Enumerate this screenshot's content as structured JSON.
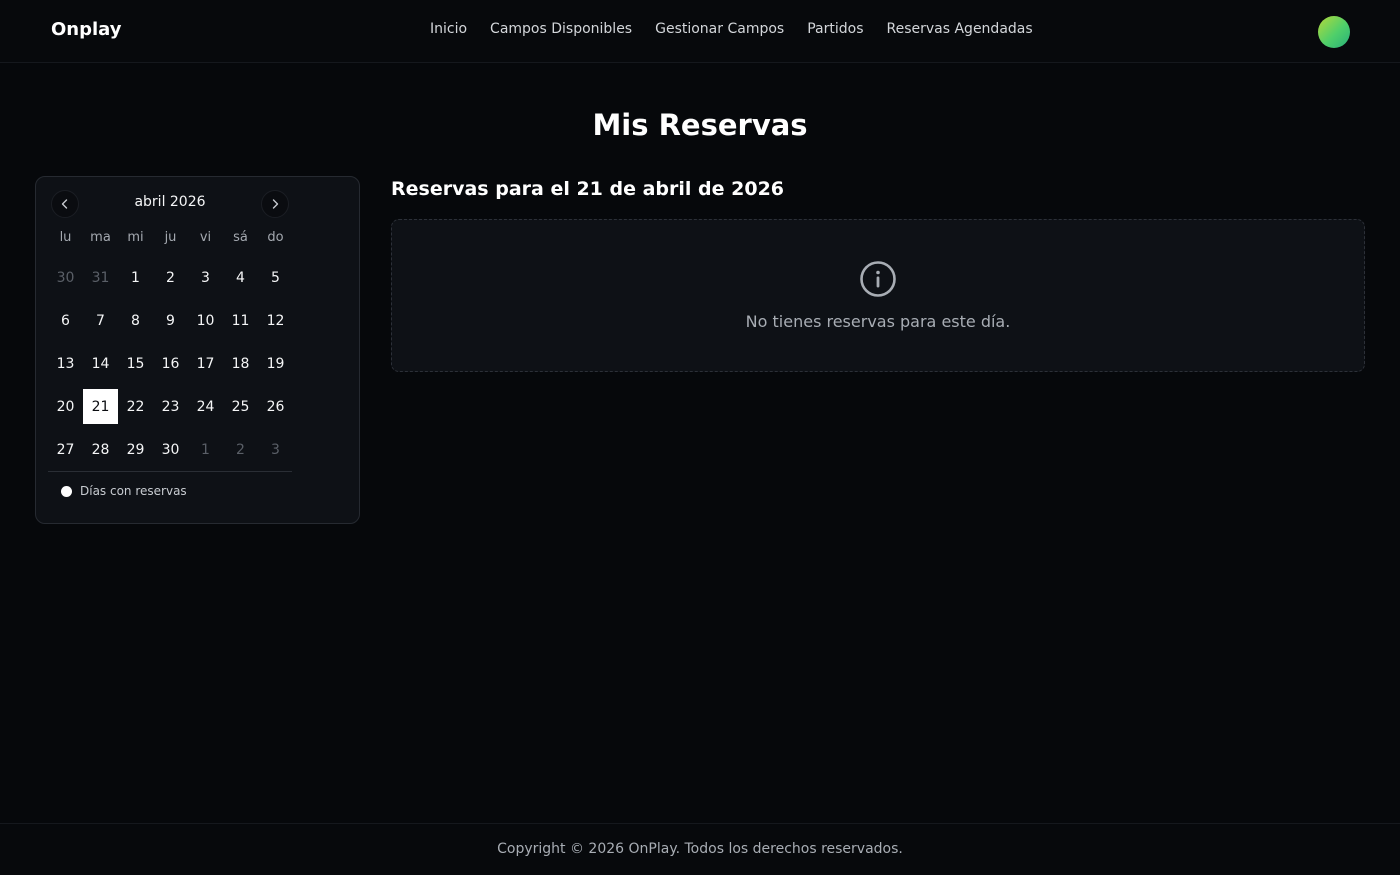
{
  "header": {
    "brand": "Onplay",
    "nav": [
      {
        "label": "Inicio"
      },
      {
        "label": "Campos Disponibles"
      },
      {
        "label": "Gestionar Campos"
      },
      {
        "label": "Partidos"
      },
      {
        "label": "Reservas Agendadas"
      }
    ],
    "avatar_gradient": [
      "#b5d93a",
      "#27b07a"
    ]
  },
  "page": {
    "title": "Mis Reservas"
  },
  "calendar": {
    "month_label": "abril 2026",
    "prev_icon": "chevron-left-icon",
    "next_icon": "chevron-right-icon",
    "weekdays": [
      "lu",
      "ma",
      "mi",
      "ju",
      "vi",
      "sá",
      "do"
    ],
    "days": [
      {
        "label": "30",
        "muted": true
      },
      {
        "label": "31",
        "muted": true
      },
      {
        "label": "1"
      },
      {
        "label": "2"
      },
      {
        "label": "3"
      },
      {
        "label": "4"
      },
      {
        "label": "5"
      },
      {
        "label": "6"
      },
      {
        "label": "7"
      },
      {
        "label": "8"
      },
      {
        "label": "9"
      },
      {
        "label": "10"
      },
      {
        "label": "11"
      },
      {
        "label": "12"
      },
      {
        "label": "13"
      },
      {
        "label": "14"
      },
      {
        "label": "15"
      },
      {
        "label": "16"
      },
      {
        "label": "17"
      },
      {
        "label": "18"
      },
      {
        "label": "19"
      },
      {
        "label": "20"
      },
      {
        "label": "21",
        "selected": true
      },
      {
        "label": "22"
      },
      {
        "label": "23"
      },
      {
        "label": "24"
      },
      {
        "label": "25"
      },
      {
        "label": "26"
      },
      {
        "label": "27"
      },
      {
        "label": "28"
      },
      {
        "label": "29"
      },
      {
        "label": "30"
      },
      {
        "label": "1",
        "muted": true
      },
      {
        "label": "2",
        "muted": true
      },
      {
        "label": "3",
        "muted": true
      }
    ],
    "legend_label": "Días con reservas"
  },
  "reservations": {
    "heading": "Reservas para el 21 de abril de 2026",
    "empty_icon": "info-circle-icon",
    "empty_text": "No tienes reservas para este día."
  },
  "footer": {
    "copyright": "Copyright © 2026 OnPlay. Todos los derechos reservados."
  },
  "colors": {
    "background": "#06080b",
    "card": "#0e1116",
    "selected_day": "#ffffff"
  }
}
